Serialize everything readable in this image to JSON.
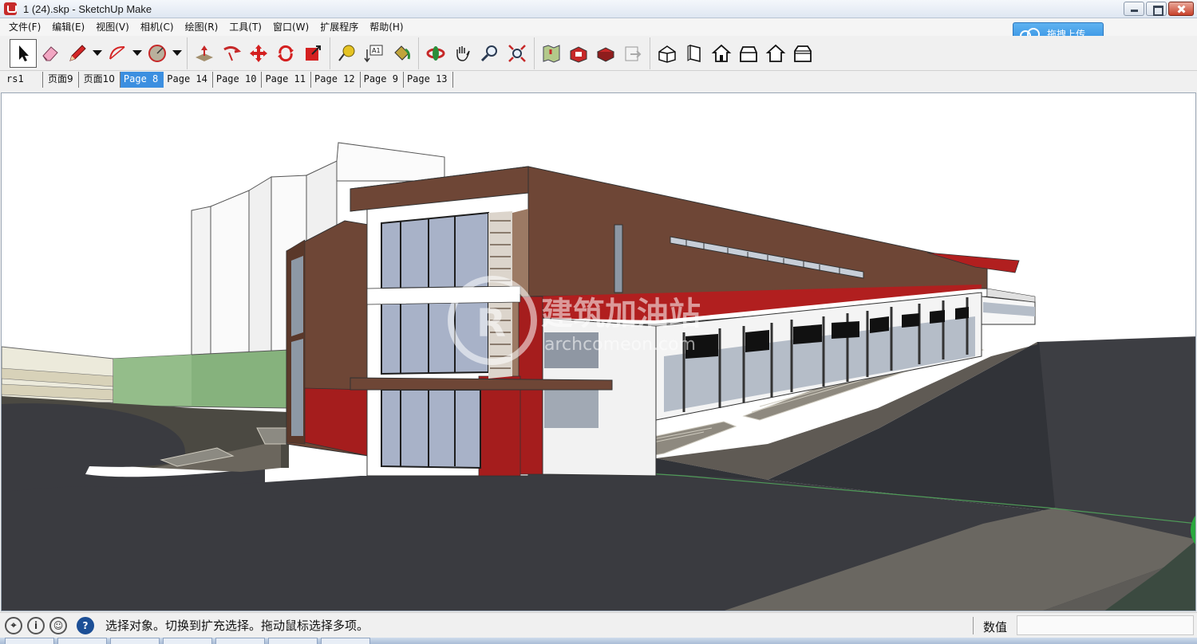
{
  "window": {
    "title": "1 (24).skp - SketchUp Make"
  },
  "menu": {
    "items": [
      "文件(F)",
      "编辑(E)",
      "视图(V)",
      "相机(C)",
      "绘图(R)",
      "工具(T)",
      "窗口(W)",
      "扩展程序",
      "帮助(H)"
    ]
  },
  "upload_button": {
    "label": "拖拽上传"
  },
  "toolbar": {
    "groups": [
      [
        "select-tool-icon",
        "eraser-tool-icon",
        "pencil-tool-icon",
        "arc-tool-icon",
        "shape-tool-icon"
      ],
      [
        "push-pull-tool-icon",
        "follow-me-tool-icon",
        "move-tool-icon",
        "rotate-tool-icon",
        "scale-tool-icon"
      ],
      [
        "tape-measure-tool-icon",
        "text-tool-icon",
        "paint-bucket-tool-icon"
      ],
      [
        "orbit-tool-icon",
        "pan-tool-icon",
        "zoom-tool-icon",
        "zoom-extents-tool-icon"
      ],
      [
        "map-icon",
        "warehouse-icon",
        "extension-warehouse-icon",
        "layout-icon"
      ],
      [
        "iso-view-icon",
        "top-view-icon",
        "front-view-icon",
        "right-view-icon",
        "back-view-icon",
        "left-view-icon"
      ]
    ],
    "text_tool_label": "A1"
  },
  "scene_tabs": {
    "tabs": [
      "rs1",
      "页面9",
      "页面10",
      "Page 8",
      "Page 14",
      "Page 10",
      "Page 11",
      "Page 12",
      "Page 9",
      "Page 13"
    ],
    "selected": "Page 8"
  },
  "viewport": {
    "watermark_cn": "建筑加油站",
    "watermark_en": "archcomeon.com"
  },
  "statusbar": {
    "message": "选择对象。切换到扩充选择。拖动鼠标选择多项。",
    "measure_label": "数值",
    "measure_value": ""
  },
  "colors": {
    "brown": "#6e4636",
    "red": "#a51d1d",
    "road": "#3a3b40",
    "selected_tab": "#3c8fe0"
  }
}
